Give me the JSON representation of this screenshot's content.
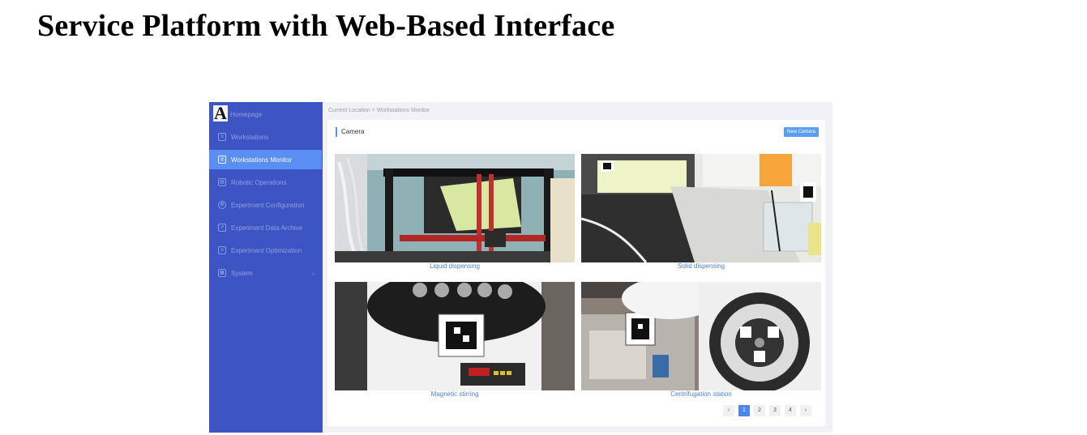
{
  "page": {
    "heading": "Service Platform with Web-Based Interface"
  },
  "app": {
    "logo": "A",
    "sidebar": {
      "items": [
        {
          "label": "Homepage",
          "icon": "logo-icon"
        },
        {
          "label": "Workstations",
          "icon": "list-icon"
        },
        {
          "label": "Workstations Monitor",
          "icon": "monitor-icon",
          "active": true
        },
        {
          "label": "Robotic Operations",
          "icon": "robot-icon"
        },
        {
          "label": "Experiment Configuration",
          "icon": "gear-icon"
        },
        {
          "label": "Experiment Data Archive",
          "icon": "chart-icon"
        },
        {
          "label": "Experiment Optimization",
          "icon": "list-icon"
        },
        {
          "label": "System",
          "icon": "system-icon",
          "expandable": true
        }
      ]
    },
    "breadcrumb": "Current Location > Workstations Monitor",
    "panel": {
      "title": "Camera",
      "new_button": "New Camera",
      "cameras": [
        {
          "label": "Liquid dispensing"
        },
        {
          "label": "Solid dispensing"
        },
        {
          "label": "Magnetic stirring"
        },
        {
          "label": "Centrifugation station"
        }
      ]
    },
    "pagination": {
      "prev": "‹",
      "pages": [
        "1",
        "2",
        "3",
        "4"
      ],
      "current": "1",
      "next": "›"
    },
    "colors": {
      "sidebar": "#3d55c4",
      "active": "#5a8ef0",
      "accent": "#4d85ee"
    }
  }
}
